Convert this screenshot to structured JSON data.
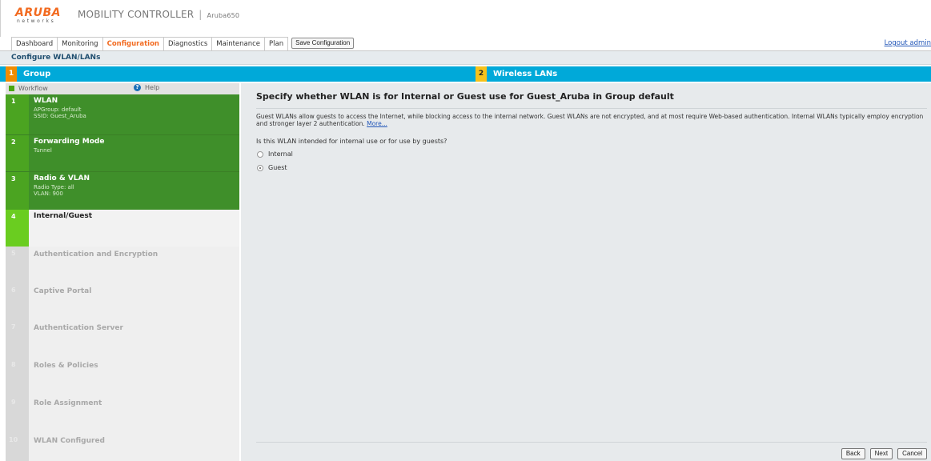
{
  "brand": {
    "logo_main": "ARUBA",
    "logo_sub": "networks",
    "product_name": "MOBILITY CONTROLLER",
    "product_sep": "|",
    "model": "Aruba650",
    "accent_color": "#f26b21"
  },
  "nav": {
    "items": [
      {
        "label": "Dashboard"
      },
      {
        "label": "Monitoring"
      },
      {
        "label": "Configuration"
      },
      {
        "label": "Diagnostics"
      },
      {
        "label": "Maintenance"
      },
      {
        "label": "Plan"
      }
    ],
    "active": "Configuration",
    "save_label": "Save Configuration",
    "logout_label": "Logout admin"
  },
  "page": {
    "title": "Configure WLAN/LANs"
  },
  "steps": [
    {
      "num": "1",
      "label": "Group"
    },
    {
      "num": "2",
      "label": "Wireless LANs"
    }
  ],
  "sidebar": {
    "workflow_label": "Workflow",
    "help_label": "Help",
    "items": [
      {
        "num": "1",
        "title": "WLAN",
        "sub1": "APGroup: default",
        "sub2": "SSID: Guest_Aruba",
        "sub3": ""
      },
      {
        "num": "2",
        "title": "Forwarding Mode",
        "sub1": "Tunnel",
        "sub2": "",
        "sub3": ""
      },
      {
        "num": "3",
        "title": "Radio & VLAN",
        "sub1": "Radio Type: all",
        "sub2": "VLAN: 900",
        "sub3": ""
      },
      {
        "num": "4",
        "title": "Internal/Guest"
      },
      {
        "num": "5",
        "title": "Authentication and Encryption"
      },
      {
        "num": "6",
        "title": "Captive Portal"
      },
      {
        "num": "7",
        "title": "Authentication Server"
      },
      {
        "num": "8",
        "title": "Roles & Policies"
      },
      {
        "num": "9",
        "title": "Role Assignment"
      },
      {
        "num": "10",
        "title": "WLAN Configured"
      }
    ]
  },
  "main": {
    "heading": "Specify whether WLAN is for Internal or Guest use for Guest_Aruba in Group default",
    "description": "Guest WLANs allow guests to access the Internet, while blocking access to the internal network. Guest WLANs are not encrypted, and at most require Web-based authentication. Internal WLANs typically employ encryption and stronger layer 2 authentication.",
    "more_link": "More...",
    "question": "Is this WLAN intended for internal use or for use by guests?",
    "options": [
      {
        "label": "Internal",
        "selected": false
      },
      {
        "label": "Guest",
        "selected": true
      }
    ],
    "buttons": {
      "back": "Back",
      "next": "Next",
      "cancel": "Cancel"
    }
  }
}
